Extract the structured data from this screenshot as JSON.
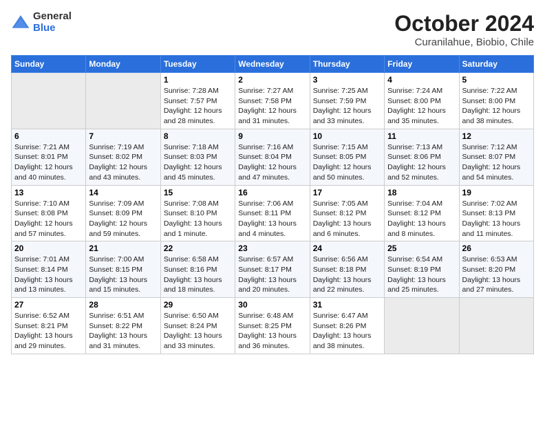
{
  "header": {
    "logo_general": "General",
    "logo_blue": "Blue",
    "month_title": "October 2024",
    "location": "Curanilahue, Biobio, Chile"
  },
  "weekdays": [
    "Sunday",
    "Monday",
    "Tuesday",
    "Wednesday",
    "Thursday",
    "Friday",
    "Saturday"
  ],
  "weeks": [
    [
      {
        "day": "",
        "empty": true
      },
      {
        "day": "",
        "empty": true
      },
      {
        "day": "1",
        "sunrise": "7:28 AM",
        "sunset": "7:57 PM",
        "daylight": "12 hours and 28 minutes."
      },
      {
        "day": "2",
        "sunrise": "7:27 AM",
        "sunset": "7:58 PM",
        "daylight": "12 hours and 31 minutes."
      },
      {
        "day": "3",
        "sunrise": "7:25 AM",
        "sunset": "7:59 PM",
        "daylight": "12 hours and 33 minutes."
      },
      {
        "day": "4",
        "sunrise": "7:24 AM",
        "sunset": "8:00 PM",
        "daylight": "12 hours and 35 minutes."
      },
      {
        "day": "5",
        "sunrise": "7:22 AM",
        "sunset": "8:00 PM",
        "daylight": "12 hours and 38 minutes."
      }
    ],
    [
      {
        "day": "6",
        "sunrise": "7:21 AM",
        "sunset": "8:01 PM",
        "daylight": "12 hours and 40 minutes."
      },
      {
        "day": "7",
        "sunrise": "7:19 AM",
        "sunset": "8:02 PM",
        "daylight": "12 hours and 43 minutes."
      },
      {
        "day": "8",
        "sunrise": "7:18 AM",
        "sunset": "8:03 PM",
        "daylight": "12 hours and 45 minutes."
      },
      {
        "day": "9",
        "sunrise": "7:16 AM",
        "sunset": "8:04 PM",
        "daylight": "12 hours and 47 minutes."
      },
      {
        "day": "10",
        "sunrise": "7:15 AM",
        "sunset": "8:05 PM",
        "daylight": "12 hours and 50 minutes."
      },
      {
        "day": "11",
        "sunrise": "7:13 AM",
        "sunset": "8:06 PM",
        "daylight": "12 hours and 52 minutes."
      },
      {
        "day": "12",
        "sunrise": "7:12 AM",
        "sunset": "8:07 PM",
        "daylight": "12 hours and 54 minutes."
      }
    ],
    [
      {
        "day": "13",
        "sunrise": "7:10 AM",
        "sunset": "8:08 PM",
        "daylight": "12 hours and 57 minutes."
      },
      {
        "day": "14",
        "sunrise": "7:09 AM",
        "sunset": "8:09 PM",
        "daylight": "12 hours and 59 minutes."
      },
      {
        "day": "15",
        "sunrise": "7:08 AM",
        "sunset": "8:10 PM",
        "daylight": "13 hours and 1 minute."
      },
      {
        "day": "16",
        "sunrise": "7:06 AM",
        "sunset": "8:11 PM",
        "daylight": "13 hours and 4 minutes."
      },
      {
        "day": "17",
        "sunrise": "7:05 AM",
        "sunset": "8:12 PM",
        "daylight": "13 hours and 6 minutes."
      },
      {
        "day": "18",
        "sunrise": "7:04 AM",
        "sunset": "8:12 PM",
        "daylight": "13 hours and 8 minutes."
      },
      {
        "day": "19",
        "sunrise": "7:02 AM",
        "sunset": "8:13 PM",
        "daylight": "13 hours and 11 minutes."
      }
    ],
    [
      {
        "day": "20",
        "sunrise": "7:01 AM",
        "sunset": "8:14 PM",
        "daylight": "13 hours and 13 minutes."
      },
      {
        "day": "21",
        "sunrise": "7:00 AM",
        "sunset": "8:15 PM",
        "daylight": "13 hours and 15 minutes."
      },
      {
        "day": "22",
        "sunrise": "6:58 AM",
        "sunset": "8:16 PM",
        "daylight": "13 hours and 18 minutes."
      },
      {
        "day": "23",
        "sunrise": "6:57 AM",
        "sunset": "8:17 PM",
        "daylight": "13 hours and 20 minutes."
      },
      {
        "day": "24",
        "sunrise": "6:56 AM",
        "sunset": "8:18 PM",
        "daylight": "13 hours and 22 minutes."
      },
      {
        "day": "25",
        "sunrise": "6:54 AM",
        "sunset": "8:19 PM",
        "daylight": "13 hours and 25 minutes."
      },
      {
        "day": "26",
        "sunrise": "6:53 AM",
        "sunset": "8:20 PM",
        "daylight": "13 hours and 27 minutes."
      }
    ],
    [
      {
        "day": "27",
        "sunrise": "6:52 AM",
        "sunset": "8:21 PM",
        "daylight": "13 hours and 29 minutes."
      },
      {
        "day": "28",
        "sunrise": "6:51 AM",
        "sunset": "8:22 PM",
        "daylight": "13 hours and 31 minutes."
      },
      {
        "day": "29",
        "sunrise": "6:50 AM",
        "sunset": "8:24 PM",
        "daylight": "13 hours and 33 minutes."
      },
      {
        "day": "30",
        "sunrise": "6:48 AM",
        "sunset": "8:25 PM",
        "daylight": "13 hours and 36 minutes."
      },
      {
        "day": "31",
        "sunrise": "6:47 AM",
        "sunset": "8:26 PM",
        "daylight": "13 hours and 38 minutes."
      },
      {
        "day": "",
        "empty": true
      },
      {
        "day": "",
        "empty": true
      }
    ]
  ],
  "labels": {
    "sunrise": "Sunrise:",
    "sunset": "Sunset:",
    "daylight": "Daylight hours"
  }
}
